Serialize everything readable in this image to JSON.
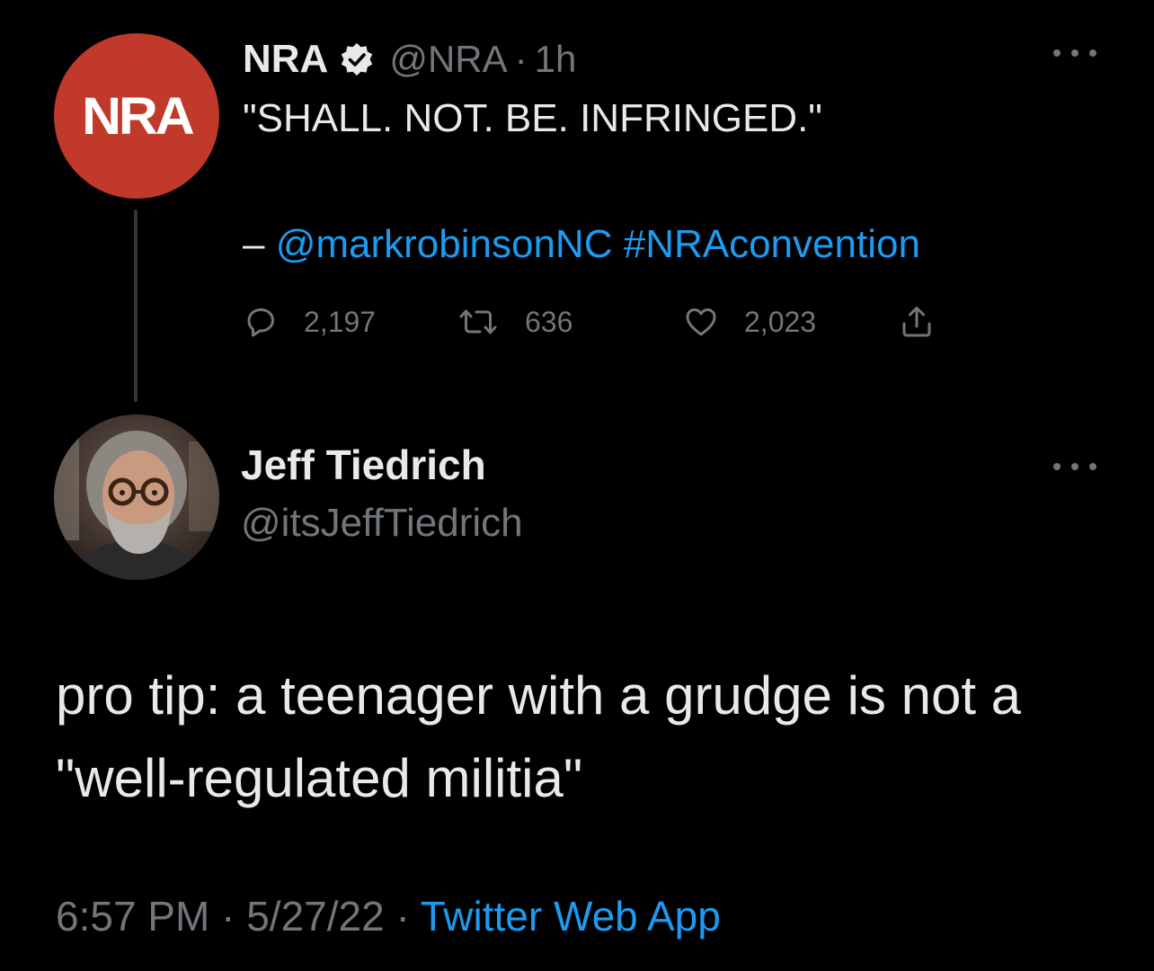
{
  "parent_tweet": {
    "avatar_logo_text": "NRA",
    "avatar_color": "#c0392b",
    "display_name": "NRA",
    "verified_icon": "verified-badge-icon",
    "handle": "@NRA",
    "separator": "·",
    "time": "1h",
    "quote_text": "\"SHALL. NOT. BE. INFRINGED.\"",
    "credit_dash": "– ",
    "credit_mention": "@markrobinsonNC",
    "credit_hashtag": "#NRAconvention",
    "actions": {
      "reply_count": "2,197",
      "retweet_count": "636",
      "like_count": "2,023"
    }
  },
  "main_tweet": {
    "display_name": "Jeff Tiedrich",
    "handle": "@itsJeffTiedrich",
    "text": "pro tip: a teenager with a grudge is not a \"well-regulated militia\"",
    "time": "6:57 PM",
    "date": "5/27/22",
    "separator": "·",
    "source": "Twitter Web App"
  },
  "colors": {
    "background": "#000000",
    "primary_text": "#e7e9ea",
    "secondary_text": "#71767b",
    "link": "#1d9bf0",
    "verified_badge": "#e7e9ea"
  }
}
